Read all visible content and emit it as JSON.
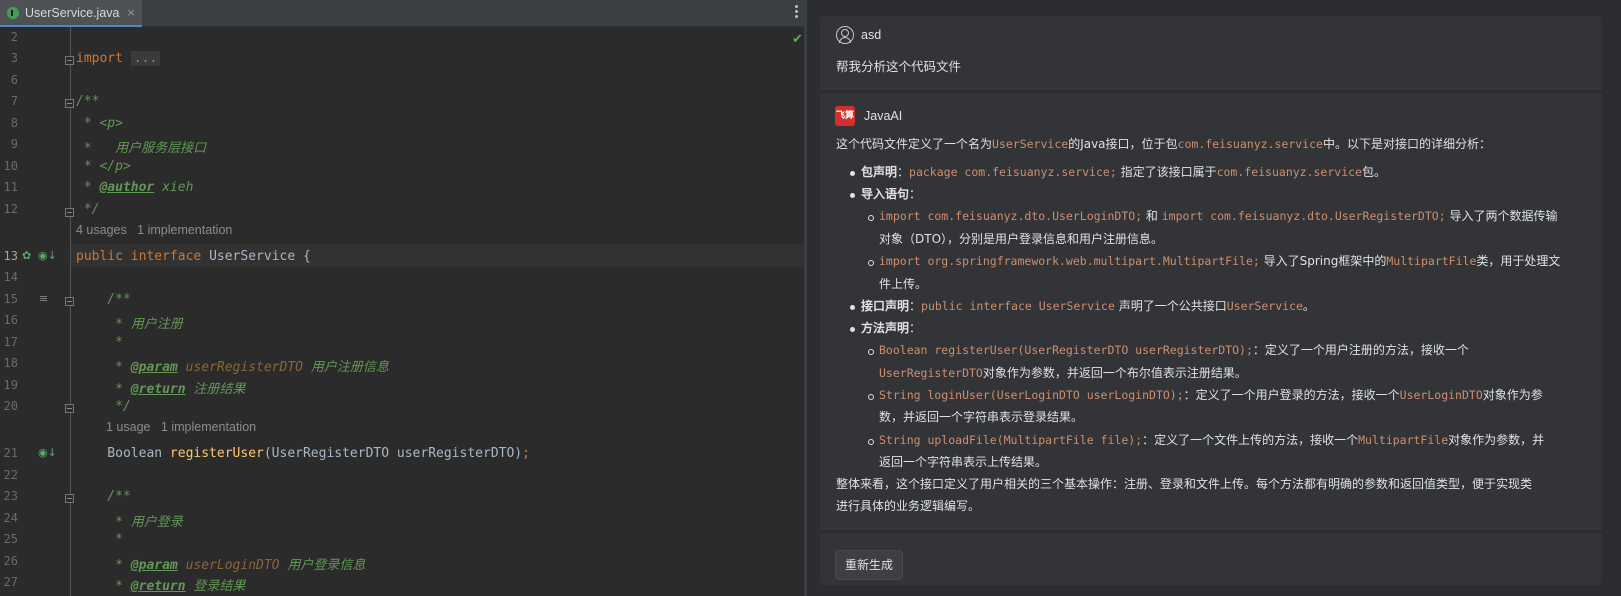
{
  "editor": {
    "tab_name": "UserService.java",
    "tab_close": "×",
    "check": "✔",
    "line_numbers": [
      "2",
      "3",
      "6",
      "7",
      "8",
      "9",
      "10",
      "11",
      "12",
      "13",
      "14",
      "15",
      "16",
      "17",
      "18",
      "19",
      "20",
      "21",
      "22",
      "23",
      "24",
      "25",
      "26",
      "27"
    ],
    "code": {
      "import_kw": "import",
      "import_fold": "...",
      "l7": "/**",
      "l8": " * <p>",
      "l9": " *   用户服务层接口",
      "l10": " * </p>",
      "l11_star": " * ",
      "l11_tag": "@author",
      "l11_val": " xieh",
      "l12": " */",
      "hint1": "4 usages   1 implementation",
      "l13_kw1": "public",
      "l13_kw2": "interface",
      "l13_rest": " UserService {",
      "l15": "    /**",
      "l16": "     * 用户注册",
      "l17": "     *",
      "l18_star": "     * ",
      "l18_tag": "@param",
      "l18_par": " userRegisterDTO",
      "l18_desc": " 用户注册信息",
      "l19_star": "     * ",
      "l19_tag": "@return",
      "l19_desc": " 注册结果",
      "l20": "     */",
      "hint2": "1 usage   1 implementation",
      "l21_type": "    Boolean ",
      "l21_fn": "registerUser",
      "l21_rest": "(UserRegisterDTO userRegisterDTO)",
      "l21_semi": ";",
      "l23": "    /**",
      "l24": "     * 用户登录",
      "l25": "     *",
      "l26_star": "     * ",
      "l26_tag": "@param",
      "l26_par": " userLoginDTO",
      "l26_desc": " 用户登录信息",
      "l27_star": "     * ",
      "l27_tag": "@return",
      "l27_desc": " 登录结果"
    }
  },
  "chat": {
    "user_name": "asd",
    "user_message": "帮我分析这个代码文件",
    "ai_name": "JavaAI",
    "ai_logo": "飞算",
    "p1_a": "这个代码文件定义了一个名为",
    "p1_b": "UserService",
    "p1_c": "的Java接口，位于包",
    "p1_d": "com.feisuanyz.service",
    "p1_e": "中。以下是对接口的详细分析：",
    "pkg_label": "包声明",
    "pkg_colon": "：",
    "pkg_code": "package com.feisuanyz.service;",
    "pkg_text1": " 指定了该接口属于",
    "pkg_code2": "com.feisuanyz.service",
    "pkg_text2": "包。",
    "imp_label": "导入语句",
    "imp_colon": "：",
    "imp1_code1": "import com.feisuanyz.dto.UserLoginDTO;",
    "imp1_and": " 和 ",
    "imp1_code2": "import com.feisuanyz.dto.UserRegisterDTO;",
    "imp1_text": " 导入了两个数据传输",
    "imp1_text2": "对象（DTO），分别是用户登录信息和用户注册信息。",
    "imp2_code": "import org.springframework.web.multipart.MultipartFile;",
    "imp2_text": " 导入了Spring框架中的",
    "imp2_code2": "MultipartFile",
    "imp2_text2": "类，用于处理文",
    "imp2_text3": "件上传。",
    "ifc_label": "接口声明",
    "ifc_colon": "：",
    "ifc_code": "public interface UserService",
    "ifc_text": " 声明了一个公共接口",
    "ifc_code2": "UserService",
    "ifc_end": "。",
    "mth_label": "方法声明",
    "mth_colon": "：",
    "m1_code": "Boolean registerUser(UserRegisterDTO userRegisterDTO);",
    "m1_text": "：定义了一个用户注册的方法，接收一个",
    "m1_code2": "UserRegisterDTO",
    "m1_text2": "对象作为参数，并返回一个布尔值表示注册结果。",
    "m2_code": "String loginUser(UserLoginDTO userLoginDTO);",
    "m2_text": "：定义了一个用户登录的方法，接收一个",
    "m2_code2": "UserLoginDTO",
    "m2_text2": "对象作为参",
    "m2_text3": "数，并返回一个字符串表示登录结果。",
    "m3_code": "String uploadFile(MultipartFile file);",
    "m3_text": "：定义了一个文件上传的方法，接收一个",
    "m3_code2": "MultipartFile",
    "m3_text2": "对象作为参数，并",
    "m3_text3": "返回一个字符串表示上传结果。",
    "summary1": "整体来看，这个接口定义了用户相关的三个基本操作：注册、登录和文件上传。每个方法都有明确的参数和返回值类型，便于实现类",
    "summary2": "进行具体的业务逻辑编写。",
    "regen": "重新生成"
  }
}
